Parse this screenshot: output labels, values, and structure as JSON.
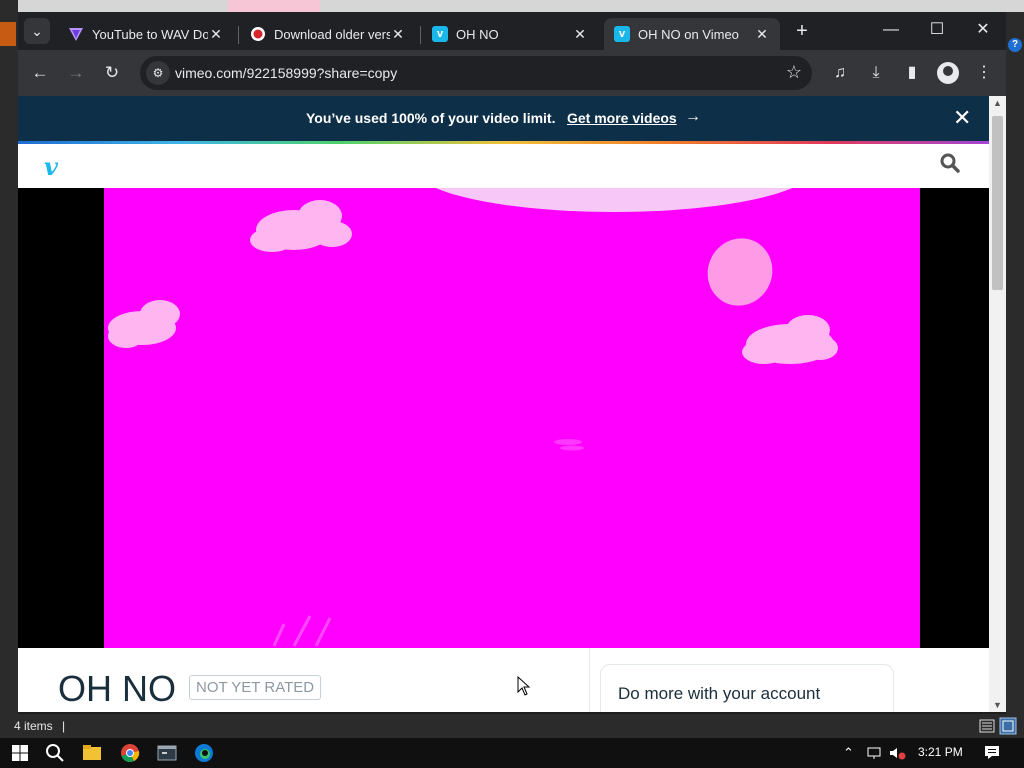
{
  "browser": {
    "tabs": [
      {
        "title": "YouTube to WAV Dow",
        "favicon": "v-triangle-icon",
        "active": false
      },
      {
        "title": "Download older versi",
        "favicon": "record-icon",
        "active": false
      },
      {
        "title": "OH NO",
        "favicon": "vimeo-icon",
        "active": false
      },
      {
        "title": "OH NO on Vimeo",
        "favicon": "vimeo-icon",
        "active": true
      }
    ],
    "url": "vimeo.com/922158999?share=copy",
    "colors": {
      "frame": "#202124",
      "toolbar": "#35363a"
    }
  },
  "banner": {
    "message": "You’ve used 100% of your video limit.",
    "link": "Get more videos",
    "arrow": "→",
    "close": "✕"
  },
  "vimeo": {
    "logo": "v",
    "accent": "#1ab7ea",
    "video_background": "#ff00ff",
    "video_title": "OH NO",
    "rating_badge": "NOT YET RATED",
    "account_card_title": "Do more with your account"
  },
  "explorer": {
    "status": "4 items",
    "caret": "|"
  },
  "taskbar": {
    "time": "3:21 PM"
  }
}
